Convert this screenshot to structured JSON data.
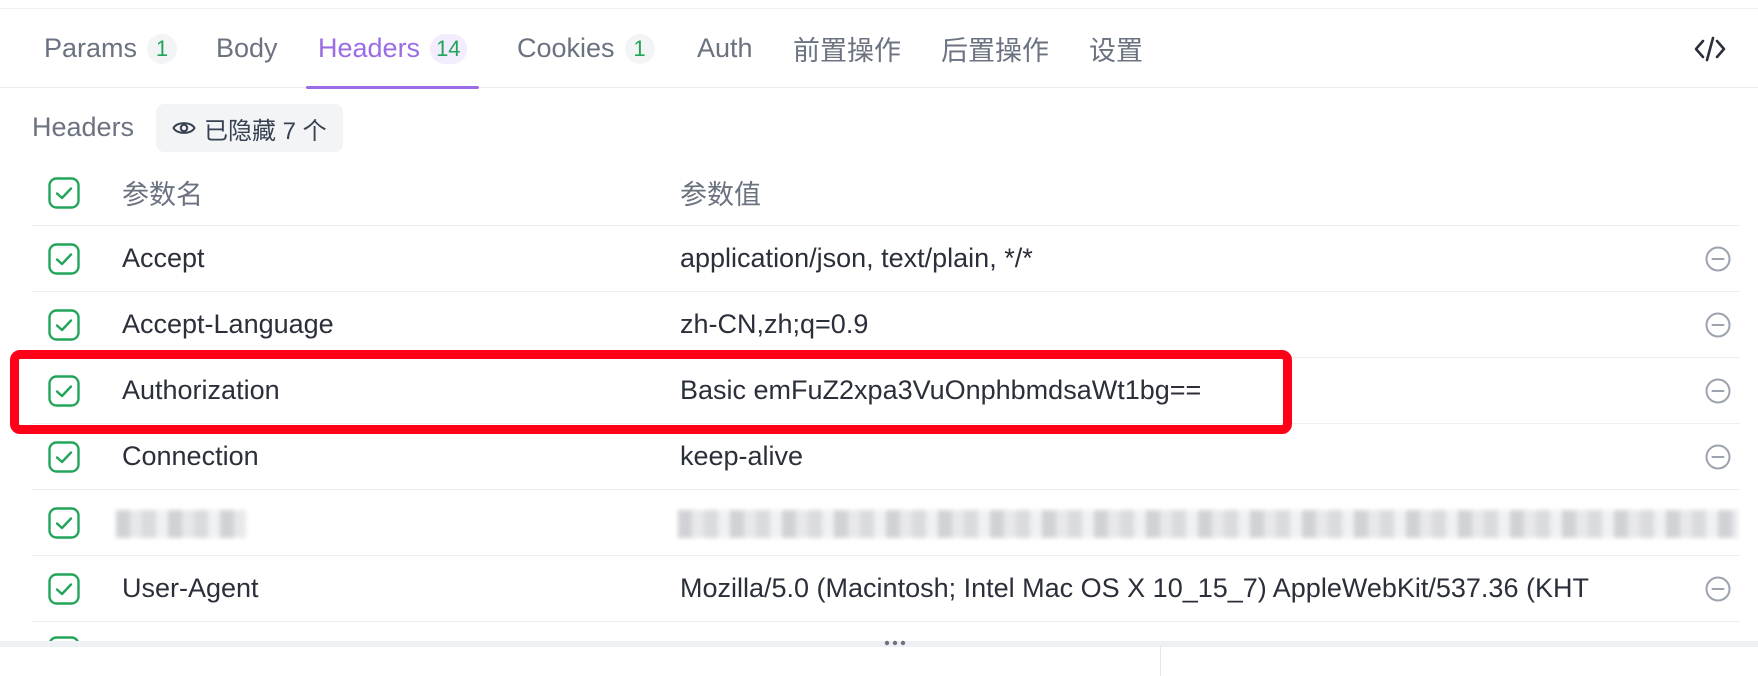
{
  "tabs": [
    {
      "label": "Params",
      "count": "1"
    },
    {
      "label": "Body",
      "count": ""
    },
    {
      "label": "Headers",
      "count": "14"
    },
    {
      "label": "Cookies",
      "count": "1"
    },
    {
      "label": "Auth",
      "count": ""
    },
    {
      "label": "前置操作",
      "count": ""
    },
    {
      "label": "后置操作",
      "count": ""
    },
    {
      "label": "设置",
      "count": ""
    }
  ],
  "active_tab": "Headers",
  "section": {
    "title": "Headers",
    "hidden_label": "已隐藏 7 个"
  },
  "table": {
    "headers": {
      "name": "参数名",
      "value": "参数值"
    },
    "rows": [
      {
        "name": "Accept",
        "value": "application/json, text/plain, */*"
      },
      {
        "name": "Accept-Language",
        "value": "zh-CN,zh;q=0.9"
      },
      {
        "name": "Authorization",
        "value": "Basic emFuZ2xpa3VuOnphbmdsaWt1bg=="
      },
      {
        "name": "Connection",
        "value": "keep-alive"
      },
      {
        "name": "User-Agent",
        "value": "Mozilla/5.0 (Macintosh; Intel Mac OS X 10_15_7) AppleWebKit/537.36 (KHT"
      }
    ]
  },
  "colors": {
    "accent": "#9b6ce6",
    "check": "#22a55a",
    "highlight": "#ff0018"
  },
  "icons": [
    "code-icon",
    "eye-icon",
    "checkbox-checked-icon",
    "remove-circle-icon",
    "drag-handle-icon"
  ]
}
